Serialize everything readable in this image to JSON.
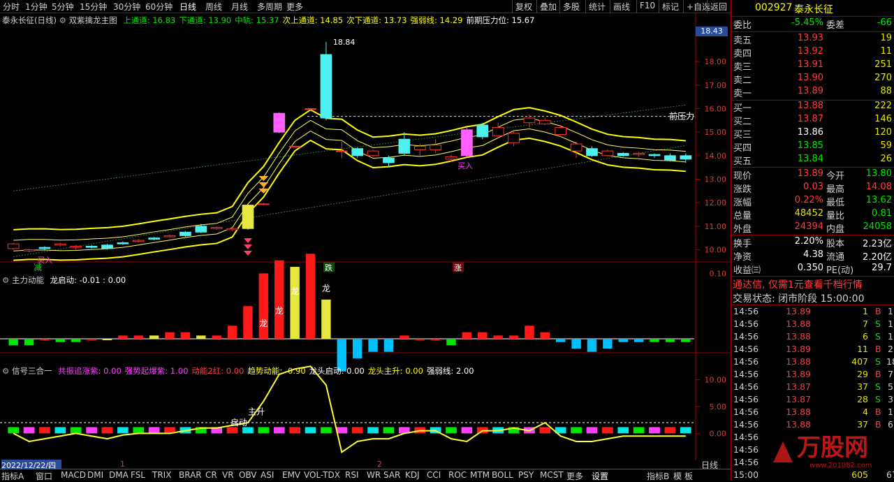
{
  "toolbar": {
    "periods": [
      "分时",
      "1分钟",
      "5分钟",
      "15分钟",
      "30分钟",
      "60分钟",
      "日线",
      "周线",
      "月线",
      "多周期",
      "更多"
    ],
    "active_period": "日线",
    "right_buttons": [
      "复权",
      "叠加",
      "多股",
      "统计",
      "画线",
      "F10",
      "标记",
      "+自选",
      "返回"
    ]
  },
  "main_panel": {
    "title": "泰永长征(日线)",
    "indicator_name": "双紫擒龙主图",
    "params": [
      {
        "label": "上通道: 16.83",
        "color": "#00e600"
      },
      {
        "label": "下通道: 13.90",
        "color": "#00e600"
      },
      {
        "label": "中轨: 15.37",
        "color": "#00e600"
      },
      {
        "label": "次上通道: 14.85",
        "color": "#ffff00"
      },
      {
        "label": "次下通道: 13.73",
        "color": "#ffff00"
      },
      {
        "label": "强弱线: 14.29",
        "color": "#ffff00"
      },
      {
        "label": "前期压力位: 15.67",
        "color": "#ffffff"
      }
    ],
    "price_axis": [
      "18.00",
      "17.00",
      "16.00",
      "15.00",
      "14.00",
      "13.00",
      "12.00",
      "11.00",
      "10.00"
    ],
    "current_price_tag": "18.43",
    "peak_label": "18.84",
    "pressure_label": "前压力",
    "signals": {
      "buy1": "买入",
      "buy2": "买入",
      "reduce": "减",
      "fall": "跌",
      "rise": "涨"
    }
  },
  "panel2": {
    "title": "主力动能",
    "params": [
      {
        "label": "龙启动: -0.01 : 0.00",
        "color": "#ffffff"
      }
    ],
    "axis_label": "0.10",
    "dragon_label": "龙"
  },
  "panel3": {
    "title": "信号三合一",
    "params": [
      {
        "label": "共振追涨紫: 0.00",
        "color": "#ff40ff"
      },
      {
        "label": "强势起爆紫: 1.00",
        "color": "#ff40ff"
      },
      {
        "label": "动能2红: 0.00",
        "color": "#ff4040"
      },
      {
        "label": "趋势动能: -0.90",
        "color": "#ffff00"
      },
      {
        "label": "龙头启动: 0.00",
        "color": "#ffffff"
      },
      {
        "label": "龙头主升: 0.00",
        "color": "#ffff00"
      },
      {
        "label": "强弱线: 2.00",
        "color": "#ffffff"
      }
    ],
    "axis": [
      "10.00",
      "5.00",
      "0.00"
    ],
    "start_label": "启动",
    "main_label": "主升"
  },
  "date_bar": {
    "date": "2022/12/22/四",
    "mark1": "1",
    "mark2": "2",
    "period": "日线"
  },
  "bottom_tabs": [
    "指标A",
    "窗口",
    "MACD",
    "DMI",
    "DMA",
    "FSL",
    "TRIX",
    "BRAR",
    "CR",
    "VR",
    "OBV",
    "ASI",
    "EMV",
    "VOL-TDX",
    "RSI",
    "WR",
    "SAR",
    "KDJ",
    "CCI",
    "ROC",
    "MTM",
    "BOLL",
    "PSY",
    "MCST",
    "更多",
    "设置"
  ],
  "bottom_right": [
    "指标B",
    "模",
    "板"
  ],
  "quote": {
    "code": "002927",
    "name": "泰永长征",
    "webi_label": "委比",
    "webi": "-5.45%",
    "weicha_label": "委差",
    "weicha": "-66",
    "asks": [
      {
        "label": "卖五",
        "price": "13.93",
        "vol": "19"
      },
      {
        "label": "卖四",
        "price": "13.92",
        "vol": "11"
      },
      {
        "label": "卖三",
        "price": "13.91",
        "vol": "251"
      },
      {
        "label": "卖二",
        "price": "13.90",
        "vol": "270"
      },
      {
        "label": "卖一",
        "price": "13.89",
        "vol": "88"
      }
    ],
    "bids": [
      {
        "label": "买一",
        "price": "13.88",
        "vol": "222",
        "pc": "red"
      },
      {
        "label": "买二",
        "price": "13.87",
        "vol": "146",
        "pc": "red"
      },
      {
        "label": "买三",
        "price": "13.86",
        "vol": "120",
        "pc": "white"
      },
      {
        "label": "买四",
        "price": "13.85",
        "vol": "59",
        "pc": "green"
      },
      {
        "label": "买五",
        "price": "13.84",
        "vol": "26",
        "pc": "green"
      }
    ],
    "stats": [
      {
        "l1": "现价",
        "v1": "13.89",
        "c1": "red",
        "l2": "今开",
        "v2": "13.80",
        "c2": "green"
      },
      {
        "l1": "涨跌",
        "v1": "0.03",
        "c1": "red",
        "l2": "最高",
        "v2": "14.08",
        "c2": "red"
      },
      {
        "l1": "涨幅",
        "v1": "0.22%",
        "c1": "red",
        "l2": "最低",
        "v2": "13.62",
        "c2": "green"
      },
      {
        "l1": "总量",
        "v1": "48452",
        "c1": "yellow",
        "l2": "量比",
        "v2": "0.81",
        "c2": "green"
      },
      {
        "l1": "外盘",
        "v1": "24394",
        "c1": "red",
        "l2": "内盘",
        "v2": "24058",
        "c2": "green"
      }
    ],
    "stats2": [
      {
        "l1": "换手",
        "v1": "2.20%",
        "l2": "股本",
        "v2": "2.23亿"
      },
      {
        "l1": "净资",
        "v1": "4.38",
        "l2": "流通",
        "v2": "2.20亿"
      },
      {
        "l1": "收益㈢",
        "v1": "0.350",
        "l2": "PE(动)",
        "v2": "29.7"
      }
    ],
    "promo": "通达信, 仅需1元查看千档行情",
    "trade_status": "交易状态: 闭市阶段 15:00:00",
    "ticks": [
      {
        "t": "14:56",
        "p": "13.89",
        "v": "1",
        "d": "B",
        "n": "1"
      },
      {
        "t": "14:56",
        "p": "13.88",
        "v": "7",
        "d": "S",
        "n": "1"
      },
      {
        "t": "14:56",
        "p": "13.88",
        "v": "6",
        "d": "S",
        "n": "1"
      },
      {
        "t": "14:56",
        "p": "13.89",
        "v": "11",
        "d": "B",
        "n": "2"
      },
      {
        "t": "14:56",
        "p": "13.88",
        "v": "407",
        "d": "S",
        "n": "18"
      },
      {
        "t": "14:56",
        "p": "13.89",
        "v": "29",
        "d": "B",
        "n": "7"
      },
      {
        "t": "14:56",
        "p": "13.87",
        "v": "37",
        "d": "S",
        "n": "5"
      },
      {
        "t": "14:56",
        "p": "13.87",
        "v": "28",
        "d": "S",
        "n": "3"
      },
      {
        "t": "14:56",
        "p": "13.88",
        "v": "4",
        "d": "B",
        "n": "1"
      },
      {
        "t": "14:56",
        "p": "13.88",
        "v": "37",
        "d": "B",
        "n": "6"
      },
      {
        "t": "14:56",
        "p": "",
        "v": "",
        "d": "",
        "n": ""
      },
      {
        "t": "14:56",
        "p": "",
        "v": "",
        "d": "",
        "n": ""
      },
      {
        "t": "14:56",
        "p": "",
        "v": "",
        "d": "",
        "n": ""
      },
      {
        "t": "15:00",
        "p": "",
        "v": "605",
        "d": "",
        "n": "67"
      }
    ],
    "watermark": "万股网",
    "watermark_url": "www.201082.com"
  },
  "chart_data": {
    "type": "candlestick",
    "ylim": [
      9.6,
      19.4
    ],
    "candles": [
      [
        10.05,
        10.25,
        10.0,
        10.3
      ],
      [
        9.95,
        10.0,
        9.9,
        10.05
      ],
      [
        10.1,
        10.05,
        10.0,
        10.15
      ],
      [
        10.2,
        10.25,
        10.15,
        10.3
      ],
      [
        10.1,
        10.15,
        10.0,
        10.2
      ],
      [
        10.15,
        10.1,
        10.05,
        10.2
      ],
      [
        10.2,
        10.05,
        10.0,
        10.25
      ],
      [
        10.3,
        10.25,
        10.2,
        10.35
      ],
      [
        10.35,
        10.4,
        10.3,
        10.45
      ],
      [
        10.5,
        10.45,
        10.4,
        10.55
      ],
      [
        10.55,
        10.6,
        10.5,
        10.65
      ],
      [
        10.75,
        10.6,
        10.55,
        10.8
      ],
      [
        11.0,
        10.75,
        10.7,
        11.1
      ],
      [
        10.9,
        10.95,
        10.85,
        11.0
      ],
      [
        10.85,
        10.9,
        10.8,
        10.95
      ],
      [
        11.9,
        10.9,
        10.85,
        11.95
      ],
      [
        11.95,
        11.95,
        11.9,
        12.0
      ],
      [
        15.0,
        15.8,
        14.95,
        15.85
      ],
      [
        14.4,
        14.4,
        14.4,
        14.4
      ],
      [
        16.0,
        16.0,
        16.0,
        16.0
      ],
      [
        18.3,
        15.6,
        15.5,
        18.84
      ],
      [
        14.2,
        14.2,
        13.9,
        14.6
      ],
      [
        14.3,
        14.0,
        13.9,
        14.35
      ],
      [
        14.0,
        14.2,
        13.95,
        14.25
      ],
      [
        13.9,
        13.7,
        13.5,
        14.0
      ],
      [
        14.7,
        14.1,
        14.0,
        15.0
      ],
      [
        14.25,
        14.4,
        14.0,
        14.5
      ],
      [
        14.25,
        14.45,
        14.1,
        14.7
      ],
      [
        13.85,
        13.95,
        13.75,
        14.05
      ],
      [
        15.1,
        14.0,
        13.95,
        15.2
      ],
      [
        15.3,
        14.8,
        14.7,
        15.4
      ],
      [
        14.85,
        15.2,
        14.75,
        15.4
      ],
      [
        14.55,
        14.95,
        14.4,
        15.1
      ],
      [
        15.4,
        15.6,
        15.2,
        15.75
      ],
      [
        15.35,
        15.5,
        15.3,
        15.6
      ],
      [
        14.9,
        15.2,
        14.8,
        15.3
      ],
      [
        14.2,
        14.5,
        13.9,
        14.6
      ],
      [
        14.3,
        14.0,
        13.95,
        14.4
      ],
      [
        14.0,
        14.2,
        13.95,
        14.25
      ],
      [
        14.1,
        14.0,
        13.95,
        14.15
      ],
      [
        14.05,
        14.1,
        13.95,
        14.15
      ],
      [
        14.05,
        14.0,
        13.9,
        14.1
      ],
      [
        14.0,
        13.8,
        13.75,
        14.1
      ],
      [
        14.0,
        13.85,
        13.7,
        14.1
      ]
    ],
    "bull_colors": [
      "#ff3030",
      "#ff3030"
    ],
    "bear_color": "#4ff0f0",
    "main_energy": [
      -0.01,
      -0.01,
      0.0,
      -0.005,
      -0.005,
      0.0,
      0.0,
      0.005,
      0.005,
      0.005,
      0.01,
      0.01,
      0.005,
      0.005,
      0.02,
      0.05,
      0.1,
      0.12,
      0.11,
      0.13,
      0.06,
      -0.05,
      -0.03,
      -0.02,
      -0.02,
      0.005,
      0.0,
      0.0,
      -0.01,
      0.01,
      0.01,
      0.005,
      0.005,
      0.02,
      0.01,
      -0.005,
      -0.015,
      -0.02,
      -0.015,
      -0.005,
      -0.005,
      -0.005,
      -0.005,
      -0.005
    ],
    "trend_line": [
      0.0,
      -1.5,
      -1.0,
      -0.5,
      0.0,
      -0.5,
      -1.0,
      -0.3,
      0.0,
      0.0,
      0.0,
      0.5,
      1.0,
      1.0,
      1.5,
      2.0,
      6.0,
      11.0,
      12.0,
      12.5,
      9.0,
      -3.5,
      -1.5,
      -1.0,
      -1.0,
      0.0,
      0.5,
      0.5,
      -1.0,
      -1.5,
      0.5,
      0.5,
      1.0,
      0.5,
      2.0,
      -0.5,
      -1.5,
      -1.5,
      -1.0,
      -0.5,
      -0.5,
      -0.5,
      -0.5,
      -0.5
    ],
    "p3_ylim": [
      -4.5,
      14.5
    ]
  }
}
